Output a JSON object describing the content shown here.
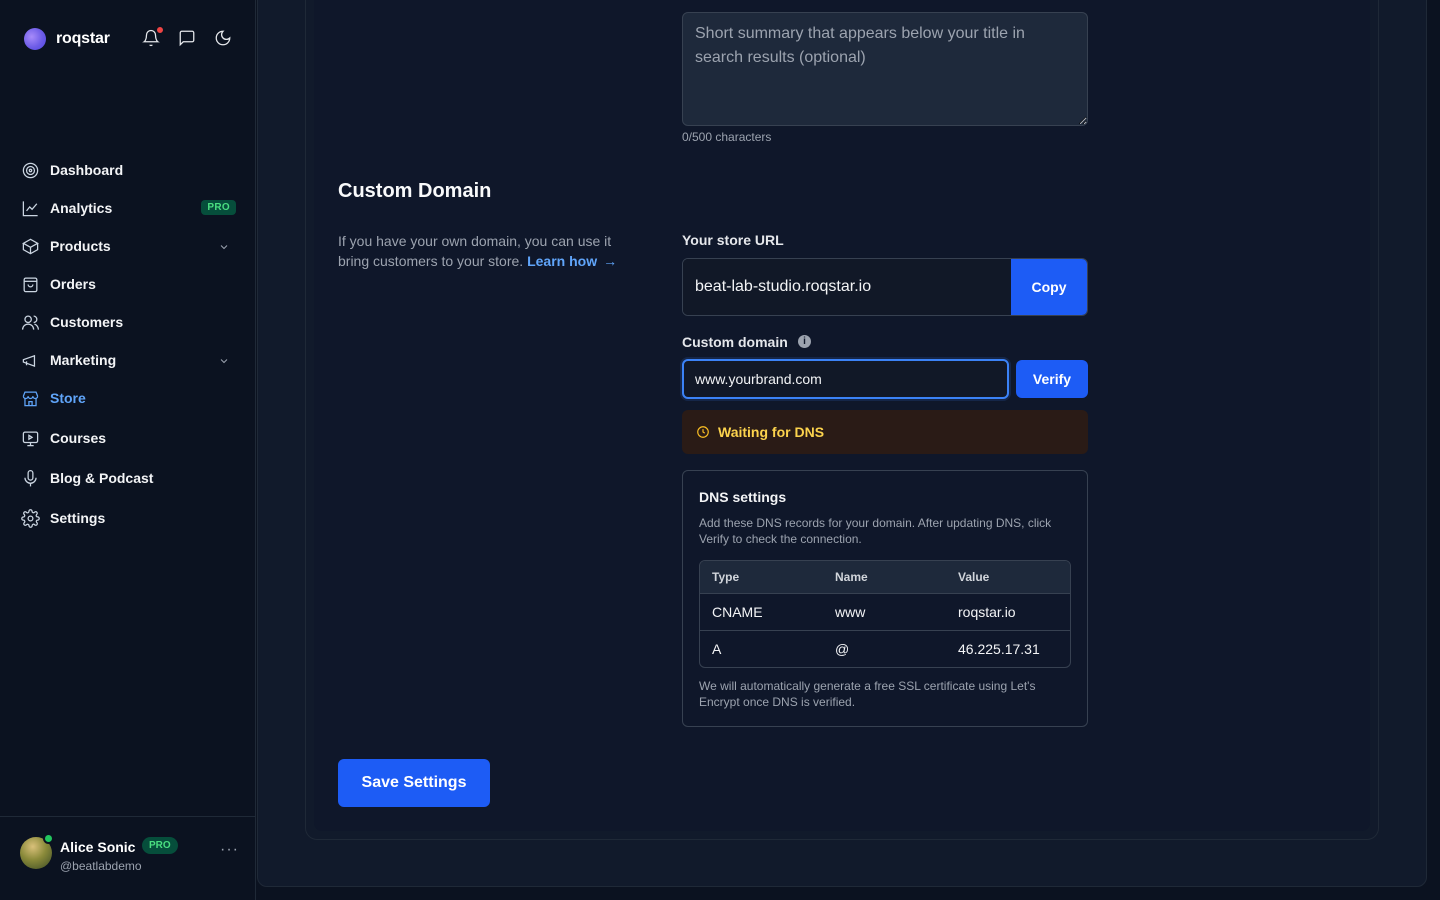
{
  "app": {
    "brand_name": "roqstar"
  },
  "top_icons": [
    "bell-icon",
    "chat-icon",
    "moon-icon"
  ],
  "sidebar": {
    "items": [
      {
        "label": "Dashboard",
        "icon": "dashboard-icon"
      },
      {
        "label": "Analytics",
        "icon": "analytics-icon",
        "badge": "PRO"
      },
      {
        "label": "Products",
        "icon": "box-icon",
        "expandable": true
      },
      {
        "label": "Orders",
        "icon": "bag-icon"
      },
      {
        "label": "Customers",
        "icon": "users-icon"
      },
      {
        "label": "Marketing",
        "icon": "megaphone-icon",
        "expandable": true
      },
      {
        "label": "Store",
        "icon": "store-icon",
        "active": true
      },
      {
        "label": "Courses",
        "icon": "courses-icon"
      },
      {
        "label": "Blog & Podcast",
        "icon": "microphone-icon"
      },
      {
        "label": "Settings",
        "icon": "gear-icon"
      }
    ]
  },
  "user": {
    "name": "Alice Sonic",
    "badge": "PRO",
    "handle": "@beatlabdemo",
    "more": "···"
  },
  "seo": {
    "summary_placeholder": "Short summary that appears below your title in search results (optional)",
    "char_count": "0/500 characters"
  },
  "custom_domain": {
    "title": "Custom Domain",
    "description": "If you have your own domain, you can use it bring customers to your store.",
    "learn_link": "Learn how",
    "learn_arrow": "→",
    "store_url_label": "Your store URL",
    "store_url_value": "beat-lab-studio.roqstar.io",
    "copy_label": "Copy",
    "custom_domain_label": "Custom domain",
    "info_glyph": "i",
    "custom_domain_value": "www.yourbrand.com",
    "verify_label": "Verify",
    "status_text": "Waiting for DNS",
    "status_color": "#fcd34d"
  },
  "dns": {
    "title": "DNS settings",
    "description": "Add these DNS records for your domain. After updating DNS, click Verify to check the connection.",
    "columns": [
      "Type",
      "Name",
      "Value"
    ],
    "rows": [
      [
        "CNAME",
        "www",
        "roqstar.io"
      ],
      [
        "A",
        "@",
        "46.225.17.31"
      ]
    ],
    "footnote": "We will automatically generate a free SSL certificate using Let's Encrypt once DNS is verified."
  },
  "actions": {
    "save_label": "Save Settings"
  },
  "colors": {
    "accent": "#1d5cf5",
    "active_nav": "#60a5fa",
    "pro_badge": "#4ade80"
  }
}
